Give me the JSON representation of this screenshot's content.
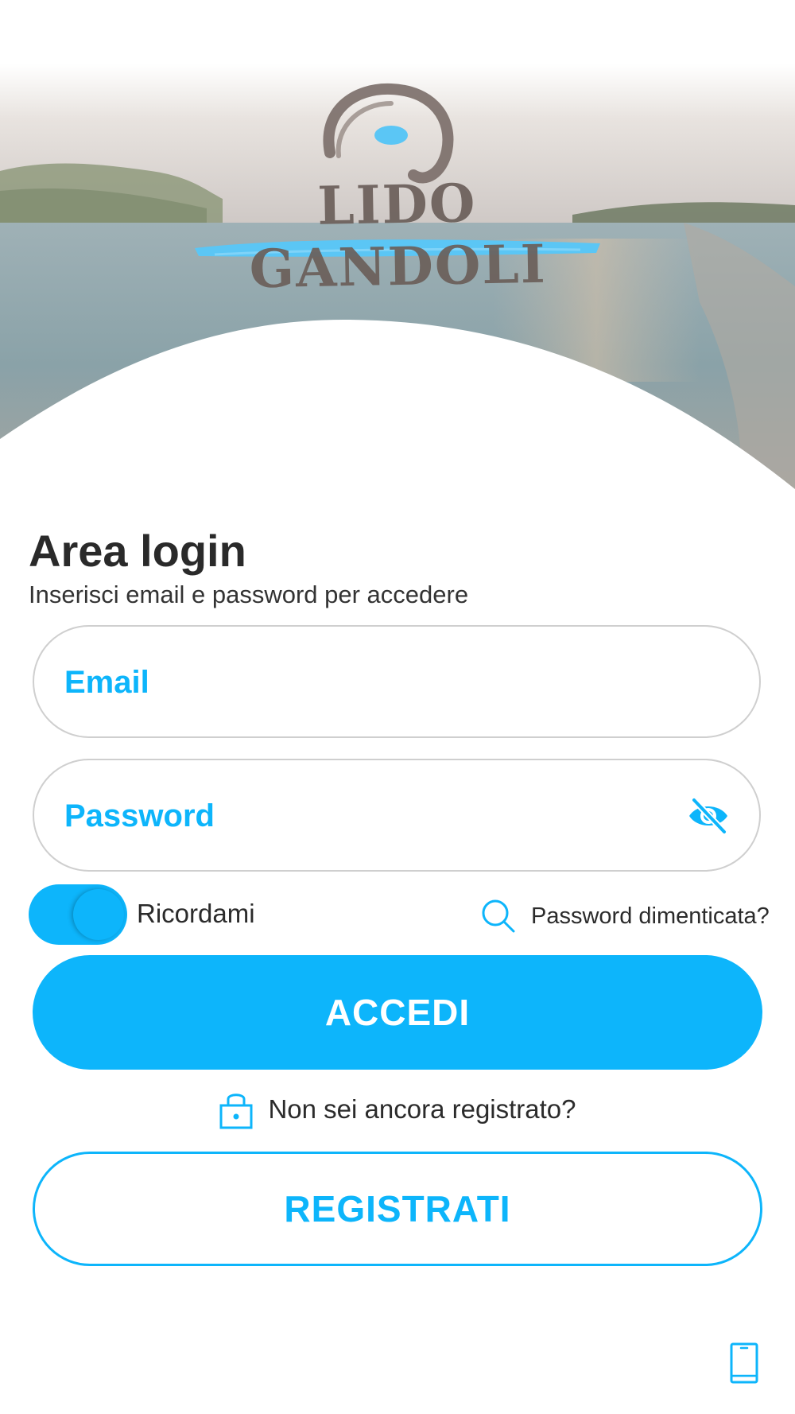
{
  "brand": {
    "logo_text": "LIDO GANDOLI"
  },
  "login": {
    "title": "Area login",
    "subtitle": "Inserisci email e password per accedere",
    "email_placeholder": "Email",
    "password_placeholder": "Password",
    "remember_label": "Ricordami",
    "remember_on": true,
    "forgot_label": "Password dimenticata?",
    "login_button": "ACCEDI",
    "register_hint": "Non sei ancora registrato?",
    "register_button": "REGISTRATI"
  },
  "icons": {
    "password_visibility": "eye-off-icon",
    "forgot": "search-icon",
    "register_hint": "lock-icon",
    "footer": "smartphone-icon"
  },
  "colors": {
    "accent": "#0db5fb",
    "text": "#2b2b2b",
    "border": "#cfcfcf",
    "logo_brown": "#6b5f5a",
    "logo_blue": "#5bc6f5"
  }
}
